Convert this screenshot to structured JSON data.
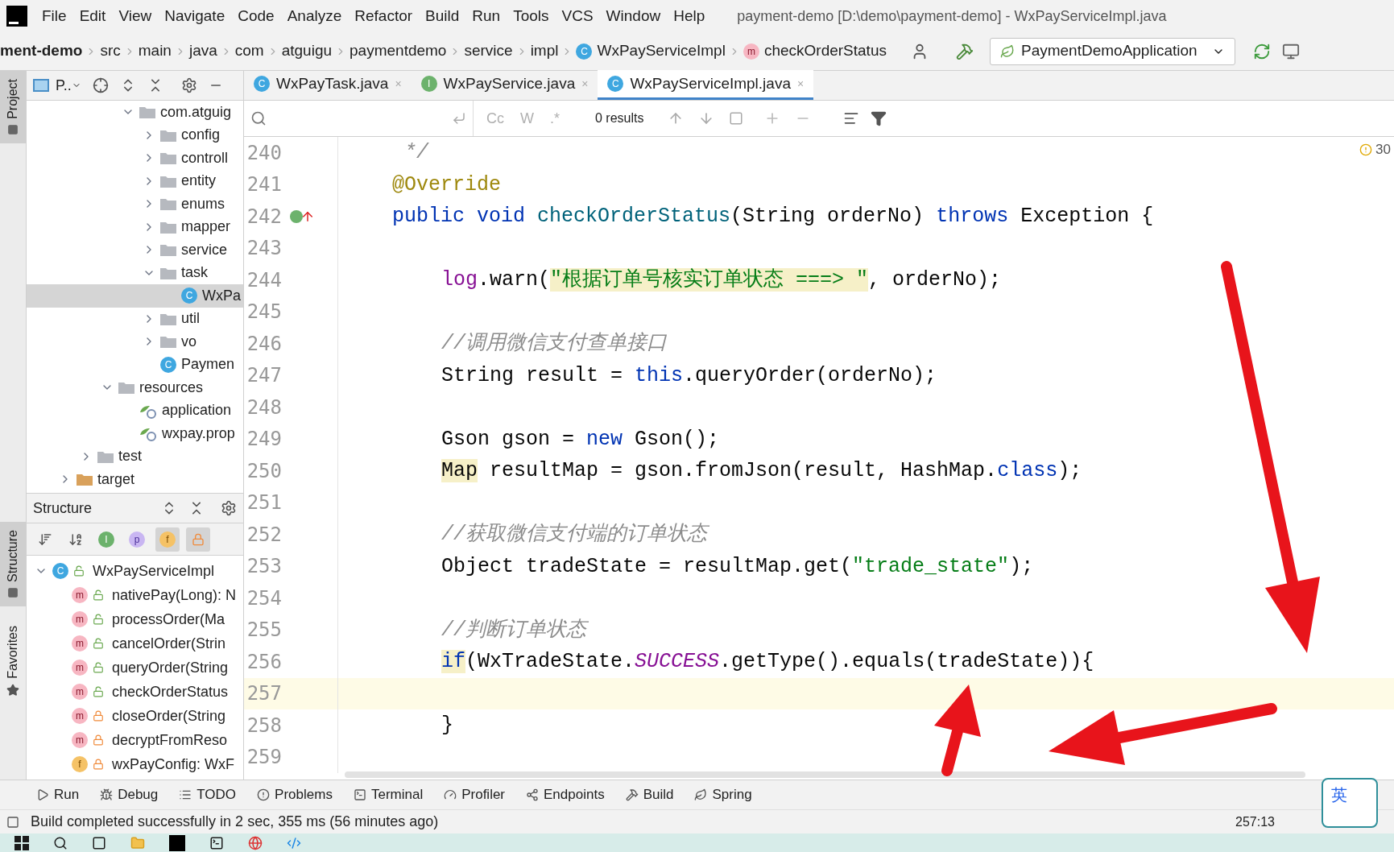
{
  "menu": {
    "items": [
      "File",
      "Edit",
      "View",
      "Navigate",
      "Code",
      "Analyze",
      "Refactor",
      "Build",
      "Run",
      "Tools",
      "VCS",
      "Window",
      "Help"
    ],
    "title": "payment-demo [D:\\demo\\payment-demo] - WxPayServiceImpl.java"
  },
  "breadcrumbs": [
    {
      "label": "ment-demo",
      "kind": "project"
    },
    {
      "label": "src",
      "kind": "folder"
    },
    {
      "label": "main",
      "kind": "folder"
    },
    {
      "label": "java",
      "kind": "folder"
    },
    {
      "label": "com",
      "kind": "folder"
    },
    {
      "label": "atguigu",
      "kind": "folder"
    },
    {
      "label": "paymentdemo",
      "kind": "folder"
    },
    {
      "label": "service",
      "kind": "folder"
    },
    {
      "label": "impl",
      "kind": "folder"
    },
    {
      "label": "WxPayServiceImpl",
      "kind": "class",
      "badge": "C"
    },
    {
      "label": "checkOrderStatus",
      "kind": "method",
      "badge": "m"
    }
  ],
  "run_config": "PaymentDemoApplication",
  "side_tabs": [
    {
      "label": "Project",
      "selected": true
    },
    {
      "label": "Structure",
      "selected": true
    },
    {
      "label": "Favorites",
      "selected": false
    }
  ],
  "project_panel": {
    "title": "P..",
    "tree": [
      {
        "label": "com.atguig",
        "kind": "folder",
        "expanded": true,
        "selected": false,
        "children": [
          {
            "label": "config",
            "kind": "folder",
            "expanded": false,
            "selected": false
          },
          {
            "label": "controll",
            "kind": "folder",
            "expanded": false,
            "selected": false
          },
          {
            "label": "entity",
            "kind": "folder",
            "expanded": false,
            "selected": false
          },
          {
            "label": "enums",
            "kind": "folder",
            "expanded": false,
            "selected": false
          },
          {
            "label": "mapper",
            "kind": "folder",
            "expanded": false,
            "selected": false
          },
          {
            "label": "service",
            "kind": "folder",
            "expanded": false,
            "selected": false
          },
          {
            "label": "task",
            "kind": "folder",
            "expanded": true,
            "selected": false,
            "children": [
              {
                "label": "WxPa",
                "kind": "class",
                "badge": "C",
                "selected": true
              }
            ]
          },
          {
            "label": "util",
            "kind": "folder",
            "expanded": false,
            "selected": false
          },
          {
            "label": "vo",
            "kind": "folder",
            "expanded": false,
            "selected": false
          },
          {
            "label": "Paymen",
            "kind": "app",
            "badge": "C",
            "selected": false
          }
        ]
      },
      {
        "label": "resources",
        "kind": "resources",
        "expanded": true,
        "selected": false,
        "children": [
          {
            "label": "application",
            "kind": "config",
            "selected": false
          },
          {
            "label": "wxpay.prop",
            "kind": "config",
            "selected": false
          }
        ]
      },
      {
        "label": "test",
        "kind": "folder",
        "expanded": false,
        "selected": false
      },
      {
        "label": "target",
        "kind": "target",
        "expanded": false,
        "selected": false
      }
    ]
  },
  "structure_panel": {
    "title": "Structure",
    "filters": [
      {
        "kind": "sort-visibility",
        "on": false
      },
      {
        "kind": "sort-alpha",
        "on": false
      },
      {
        "kind": "inherited",
        "badge": "I",
        "on": false
      },
      {
        "kind": "properties",
        "badge": "p",
        "on": false
      },
      {
        "kind": "fields",
        "badge": "f",
        "on": true
      },
      {
        "kind": "non-public",
        "on": true
      }
    ],
    "tree": [
      {
        "label": "WxPayServiceImpl",
        "badge": "C",
        "kind": "class",
        "private": false,
        "expanded": true,
        "children": [
          {
            "label": "nativePay(Long): N",
            "badge": "m",
            "kind": "method",
            "private": false
          },
          {
            "label": "processOrder(Ma",
            "badge": "m",
            "kind": "method",
            "private": false
          },
          {
            "label": "cancelOrder(Strin",
            "badge": "m",
            "kind": "method",
            "private": false
          },
          {
            "label": "queryOrder(String",
            "badge": "m",
            "kind": "method",
            "private": false
          },
          {
            "label": "checkOrderStatus",
            "badge": "m",
            "kind": "method",
            "private": false
          },
          {
            "label": "closeOrder(String",
            "badge": "m",
            "kind": "method",
            "private": true
          },
          {
            "label": "decryptFromReso",
            "badge": "m",
            "kind": "method",
            "private": true
          },
          {
            "label": "wxPayConfig: WxF",
            "badge": "f",
            "kind": "field",
            "private": true
          }
        ]
      }
    ]
  },
  "editor": {
    "tabs": [
      {
        "label": "WxPayTask.java",
        "badge": "C",
        "kind": "class",
        "close": "×",
        "selected": false
      },
      {
        "label": "WxPayService.java",
        "badge": "I",
        "kind": "interface",
        "close": "×",
        "selected": false
      },
      {
        "label": "WxPayServiceImpl.java",
        "badge": "C",
        "kind": "class",
        "close": "×",
        "selected": true
      }
    ],
    "find": {
      "options": [
        {
          "label": "Cc",
          "on": false
        },
        {
          "label": "W",
          "on": false
        },
        {
          "label": ".*",
          "on": false
        }
      ],
      "results": "0 results"
    },
    "warnings": "30",
    "lines": [
      {
        "number": "240",
        "current": false,
        "indented": false,
        "tokens": [
          {
            "text": " */",
            "kind": "comment",
            "highlighted": false
          }
        ]
      },
      {
        "number": "241",
        "current": false,
        "indented": false,
        "tokens": [
          {
            "text": "@Override",
            "kind": "annotation",
            "highlighted": false
          }
        ]
      },
      {
        "number": "242",
        "current": false,
        "implements": true,
        "indented": false,
        "tokens": [
          {
            "text": "public void ",
            "kind": "keyword",
            "highlighted": false
          },
          {
            "text": "checkOrderStatus",
            "kind": "declaration",
            "highlighted": false
          },
          {
            "text": "(String orderNo) ",
            "kind": "plain",
            "highlighted": false
          },
          {
            "text": "throws",
            "kind": "keyword",
            "highlighted": false
          },
          {
            "text": " Exception {",
            "kind": "plain",
            "highlighted": false
          }
        ]
      },
      {
        "number": "243",
        "current": false
      },
      {
        "number": "244",
        "current": false,
        "indented": true,
        "tokens": [
          {
            "text": "log",
            "kind": "field",
            "highlighted": false
          },
          {
            "text": ".warn(",
            "kind": "plain",
            "highlighted": false
          },
          {
            "text": "\"根据订单号核实订单状态 ===> \"",
            "kind": "string",
            "highlighted": true
          },
          {
            "text": ", orderNo);",
            "kind": "plain",
            "highlighted": false
          }
        ]
      },
      {
        "number": "245",
        "current": false
      },
      {
        "number": "246",
        "current": false,
        "indented": true,
        "tokens": [
          {
            "text": "//调用微信支付查单接口",
            "kind": "comment",
            "highlighted": false
          }
        ]
      },
      {
        "number": "247",
        "current": false,
        "indented": true,
        "tokens": [
          {
            "text": "String result = ",
            "kind": "plain",
            "highlighted": false
          },
          {
            "text": "this",
            "kind": "keyword",
            "highlighted": false
          },
          {
            "text": ".queryOrder(orderNo);",
            "kind": "plain",
            "highlighted": false
          }
        ]
      },
      {
        "number": "248",
        "current": false
      },
      {
        "number": "249",
        "current": false,
        "indented": true,
        "tokens": [
          {
            "text": "Gson gson = ",
            "kind": "plain",
            "highlighted": false
          },
          {
            "text": "new",
            "kind": "keyword",
            "highlighted": false
          },
          {
            "text": " Gson();",
            "kind": "plain",
            "highlighted": false
          }
        ]
      },
      {
        "number": "250",
        "current": false,
        "indented": true,
        "tokens": [
          {
            "text": "Map",
            "kind": "plain",
            "highlighted": true
          },
          {
            "text": " resultMap = gson.fromJson(result, HashMap.",
            "kind": "plain",
            "highlighted": false
          },
          {
            "text": "class",
            "kind": "keyword",
            "highlighted": false
          },
          {
            "text": ");",
            "kind": "plain",
            "highlighted": false
          }
        ]
      },
      {
        "number": "251",
        "current": false
      },
      {
        "number": "252",
        "current": false,
        "indented": true,
        "tokens": [
          {
            "text": "//获取微信支付端的订单状态",
            "kind": "comment",
            "highlighted": false
          }
        ]
      },
      {
        "number": "253",
        "current": false,
        "indented": true,
        "tokens": [
          {
            "text": "Object tradeState = resultMap.get(",
            "kind": "plain",
            "highlighted": false
          },
          {
            "text": "\"trade_state\"",
            "kind": "string",
            "highlighted": false
          },
          {
            "text": ");",
            "kind": "plain",
            "highlighted": false
          }
        ]
      },
      {
        "number": "254",
        "current": false
      },
      {
        "number": "255",
        "current": false,
        "indented": true,
        "tokens": [
          {
            "text": "//判断订单状态",
            "kind": "comment",
            "highlighted": false
          }
        ]
      },
      {
        "number": "256",
        "current": false,
        "indented": true,
        "tokens": [
          {
            "text": "if",
            "kind": "keyword",
            "highlighted": true
          },
          {
            "text": "(WxTradeState.",
            "kind": "plain",
            "highlighted": false
          },
          {
            "text": "SUCCESS",
            "kind": "constant",
            "highlighted": false
          },
          {
            "text": ".getType().equals(tradeState)){",
            "kind": "plain",
            "highlighted": false
          }
        ]
      },
      {
        "number": "257",
        "current": true
      },
      {
        "number": "258",
        "current": false,
        "indented": true,
        "tokens": [
          {
            "text": "}",
            "kind": "plain",
            "highlighted": false
          }
        ]
      },
      {
        "number": "259",
        "current": false
      }
    ]
  },
  "tool_windows": [
    {
      "label": "Run",
      "kind": "run"
    },
    {
      "label": "Debug",
      "kind": "debug"
    },
    {
      "label": "TODO",
      "kind": "todo"
    },
    {
      "label": "Problems",
      "kind": "problems"
    },
    {
      "label": "Terminal",
      "kind": "terminal"
    },
    {
      "label": "Profiler",
      "kind": "profiler"
    },
    {
      "label": "Endpoints",
      "kind": "endpoints"
    },
    {
      "label": "Build",
      "kind": "build"
    },
    {
      "label": "Spring",
      "kind": "spring"
    }
  ],
  "status": {
    "message": "Build completed successfully in 2 sec, 355 ms (56 minutes ago)",
    "position": "257:13"
  },
  "ime": "英"
}
